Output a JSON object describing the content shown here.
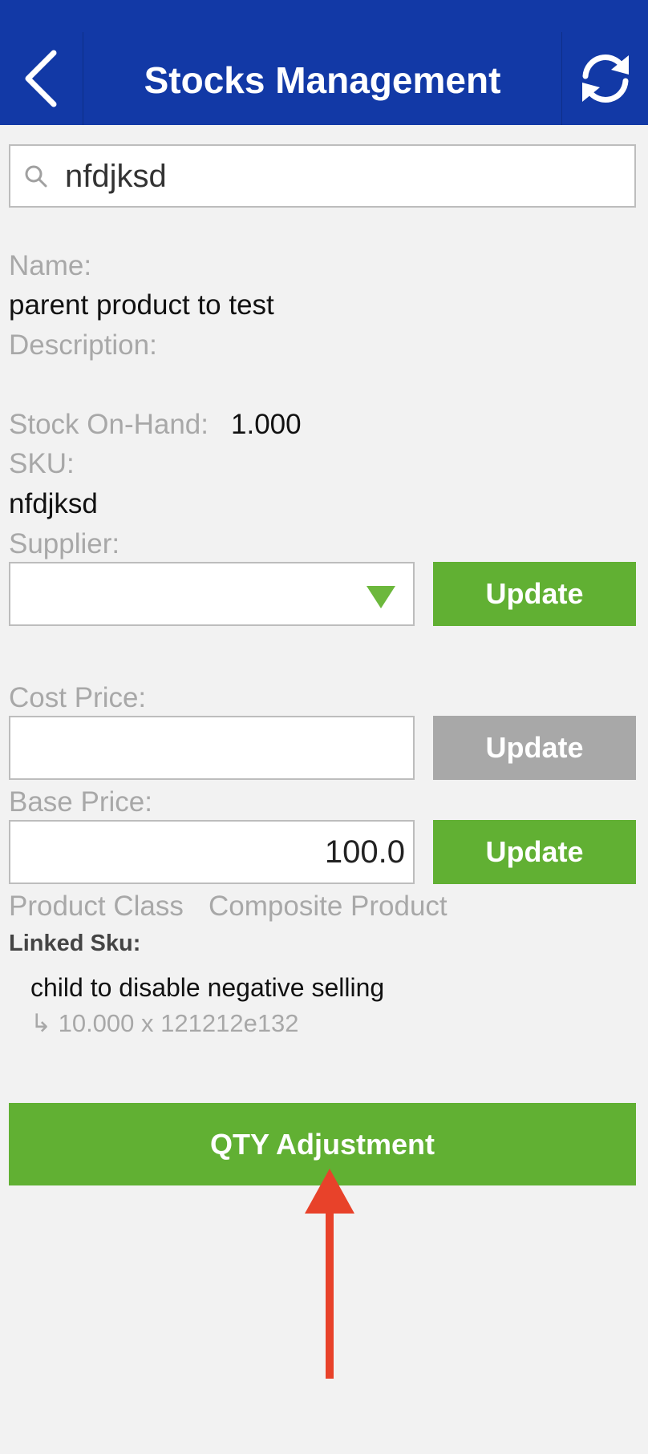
{
  "header": {
    "title": "Stocks Management",
    "back_icon": "chevron-left-icon",
    "refresh_icon": "refresh-icon",
    "bg_color": "#1239a6"
  },
  "search": {
    "value": "nfdjksd",
    "icon": "search-icon"
  },
  "product": {
    "name_label": "Name:",
    "name_value": "parent product to test",
    "description_label": "Description:",
    "stock_label": "Stock On-Hand:",
    "stock_value": "1.000",
    "sku_label": "SKU:",
    "sku_value": "nfdjksd",
    "supplier_label": "Supplier:",
    "supplier_value": "",
    "cost_label": "Cost Price:",
    "cost_value": "",
    "base_label": "Base Price:",
    "base_value": "100.0",
    "class_label": "Product Class",
    "class_value": "Composite Product",
    "linked_label": "Linked Sku:"
  },
  "linked_skus": [
    {
      "name": "child to disable negative selling",
      "detail": "↳  10.000  x  121212e132"
    }
  ],
  "buttons": {
    "update_supplier": "Update",
    "update_cost": "Update",
    "update_base": "Update",
    "qty_adjustment": "QTY Adjustment"
  },
  "colors": {
    "accent_green": "#61b033",
    "disabled_gray": "#a8a8a8",
    "annotation_red": "#e8422a"
  }
}
